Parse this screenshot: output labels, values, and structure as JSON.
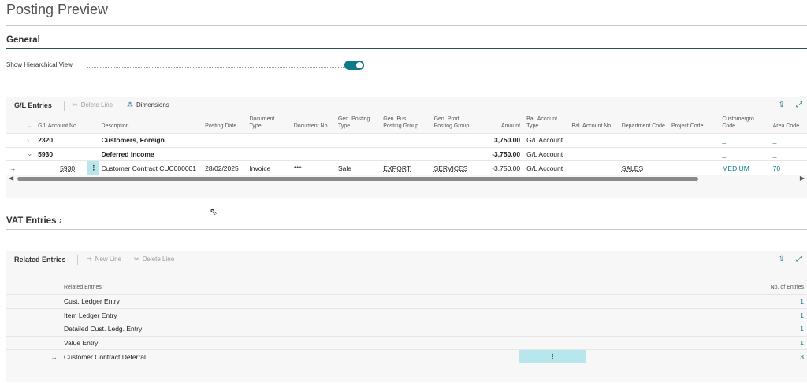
{
  "page_title": "Posting Preview",
  "general": {
    "title": "General",
    "toggle_label": "Show Hierarchical View",
    "toggle_on": true
  },
  "gl": {
    "title": "G/L Entries",
    "delete_line": "Delete Line",
    "dimensions": "Dimensions",
    "columns": [
      "G/L Account No.",
      "Description",
      "Posting Date",
      "Document Type",
      "Document No.",
      "Gen. Posting Type",
      "Gen. Bus. Posting Group",
      "Gen. Prod. Posting Group",
      "Amount",
      "Bal. Account Type",
      "Bal. Account No.",
      "Department Code",
      "Project Code",
      "Customergro... Code",
      "Area Code"
    ],
    "rows": [
      {
        "account": "2320",
        "description": "Customers, Foreign",
        "posting_date": "",
        "document_type": "",
        "document_no": "",
        "gen_posting_type": "",
        "gen_bus": "",
        "gen_prod": "",
        "amount": "3,750.00",
        "bal_type": "G/L Account",
        "bal_no": "",
        "dept": "",
        "project": "",
        "custgroup": "_",
        "area": "_"
      },
      {
        "account": "5930",
        "description": "Deferred Income",
        "posting_date": "",
        "document_type": "",
        "document_no": "",
        "gen_posting_type": "",
        "gen_bus": "",
        "gen_prod": "",
        "amount": "-3,750.00",
        "bal_type": "G/L Account",
        "bal_no": "",
        "dept": "",
        "project": "",
        "custgroup": "_",
        "area": "_"
      },
      {
        "account": "5930",
        "description": "Customer Contract CUC000001",
        "posting_date": "28/02/2025",
        "document_type": "Invoice",
        "document_no": "***",
        "gen_posting_type": "Sale",
        "gen_bus": "EXPORT",
        "gen_prod": "SERVICES",
        "amount": "-3,750.00",
        "bal_type": "G/L Account",
        "bal_no": "",
        "dept": "SALES",
        "project": "",
        "custgroup": "MEDIUM",
        "area": "70"
      }
    ]
  },
  "vat": {
    "title": "VAT Entries"
  },
  "related": {
    "title": "Related Entries",
    "new_line": "New Line",
    "delete_line": "Delete Line",
    "col_entries": "Related Entries",
    "col_count": "No. of Entries",
    "rows": [
      {
        "name": "Cust. Ledger Entry",
        "count": "1"
      },
      {
        "name": "Item Ledger Entry",
        "count": "1"
      },
      {
        "name": "Detailed Cust. Ledg. Entry",
        "count": "1"
      },
      {
        "name": "Value Entry",
        "count": "1"
      },
      {
        "name": "Customer Contract Deferral",
        "count": "3"
      }
    ]
  },
  "colors": {
    "accent": "#0f7b88",
    "selected": "#b7e6ec"
  }
}
